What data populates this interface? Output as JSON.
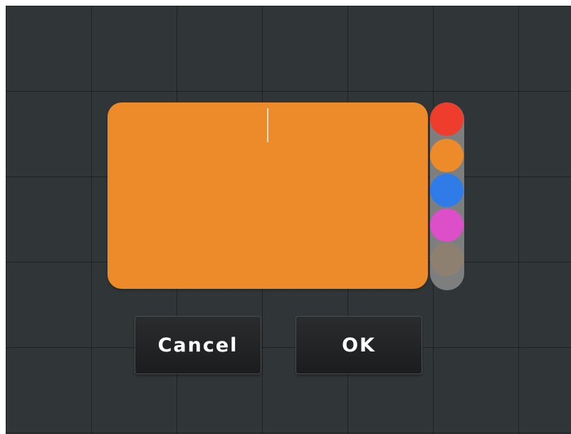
{
  "dialog": {
    "cancel_label": "Cancel",
    "ok_label": "OK"
  },
  "note": {
    "text": "",
    "background_color": "#ed8b2b"
  },
  "palette": {
    "swatches": [
      {
        "name": "red",
        "color": "#ee3d2c"
      },
      {
        "name": "orange",
        "color": "#ed8b2b"
      },
      {
        "name": "blue",
        "color": "#2f7ce9"
      },
      {
        "name": "magenta",
        "color": "#dc4fc8"
      },
      {
        "name": "taupe",
        "color": "#8e8070"
      }
    ],
    "selected": "orange"
  },
  "colors": {
    "canvas_background": "#303637",
    "palette_track": "#7d7f7f",
    "button_background": "#1f2021"
  }
}
